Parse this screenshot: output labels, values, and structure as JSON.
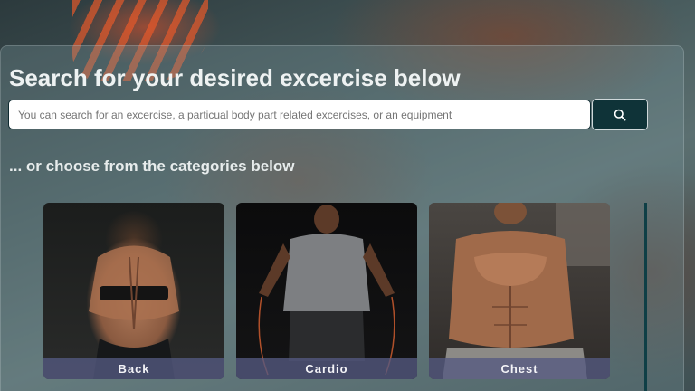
{
  "search": {
    "title": "Search for your desired excercise below",
    "placeholder": "You can search for an excercise, a particual body part related excercises, or an equipment",
    "button_icon": "search-icon"
  },
  "categories": {
    "heading": "... or choose from the categories below",
    "items": [
      {
        "label": "Back",
        "image": "back-muscles-photo"
      },
      {
        "label": "Cardio",
        "image": "cardio-jump-rope-photo"
      },
      {
        "label": "Chest",
        "image": "chest-muscles-photo"
      }
    ]
  },
  "colors": {
    "search_button": "#0f3338",
    "label_bar": "#555a82",
    "title_text": "#eef2f2"
  }
}
